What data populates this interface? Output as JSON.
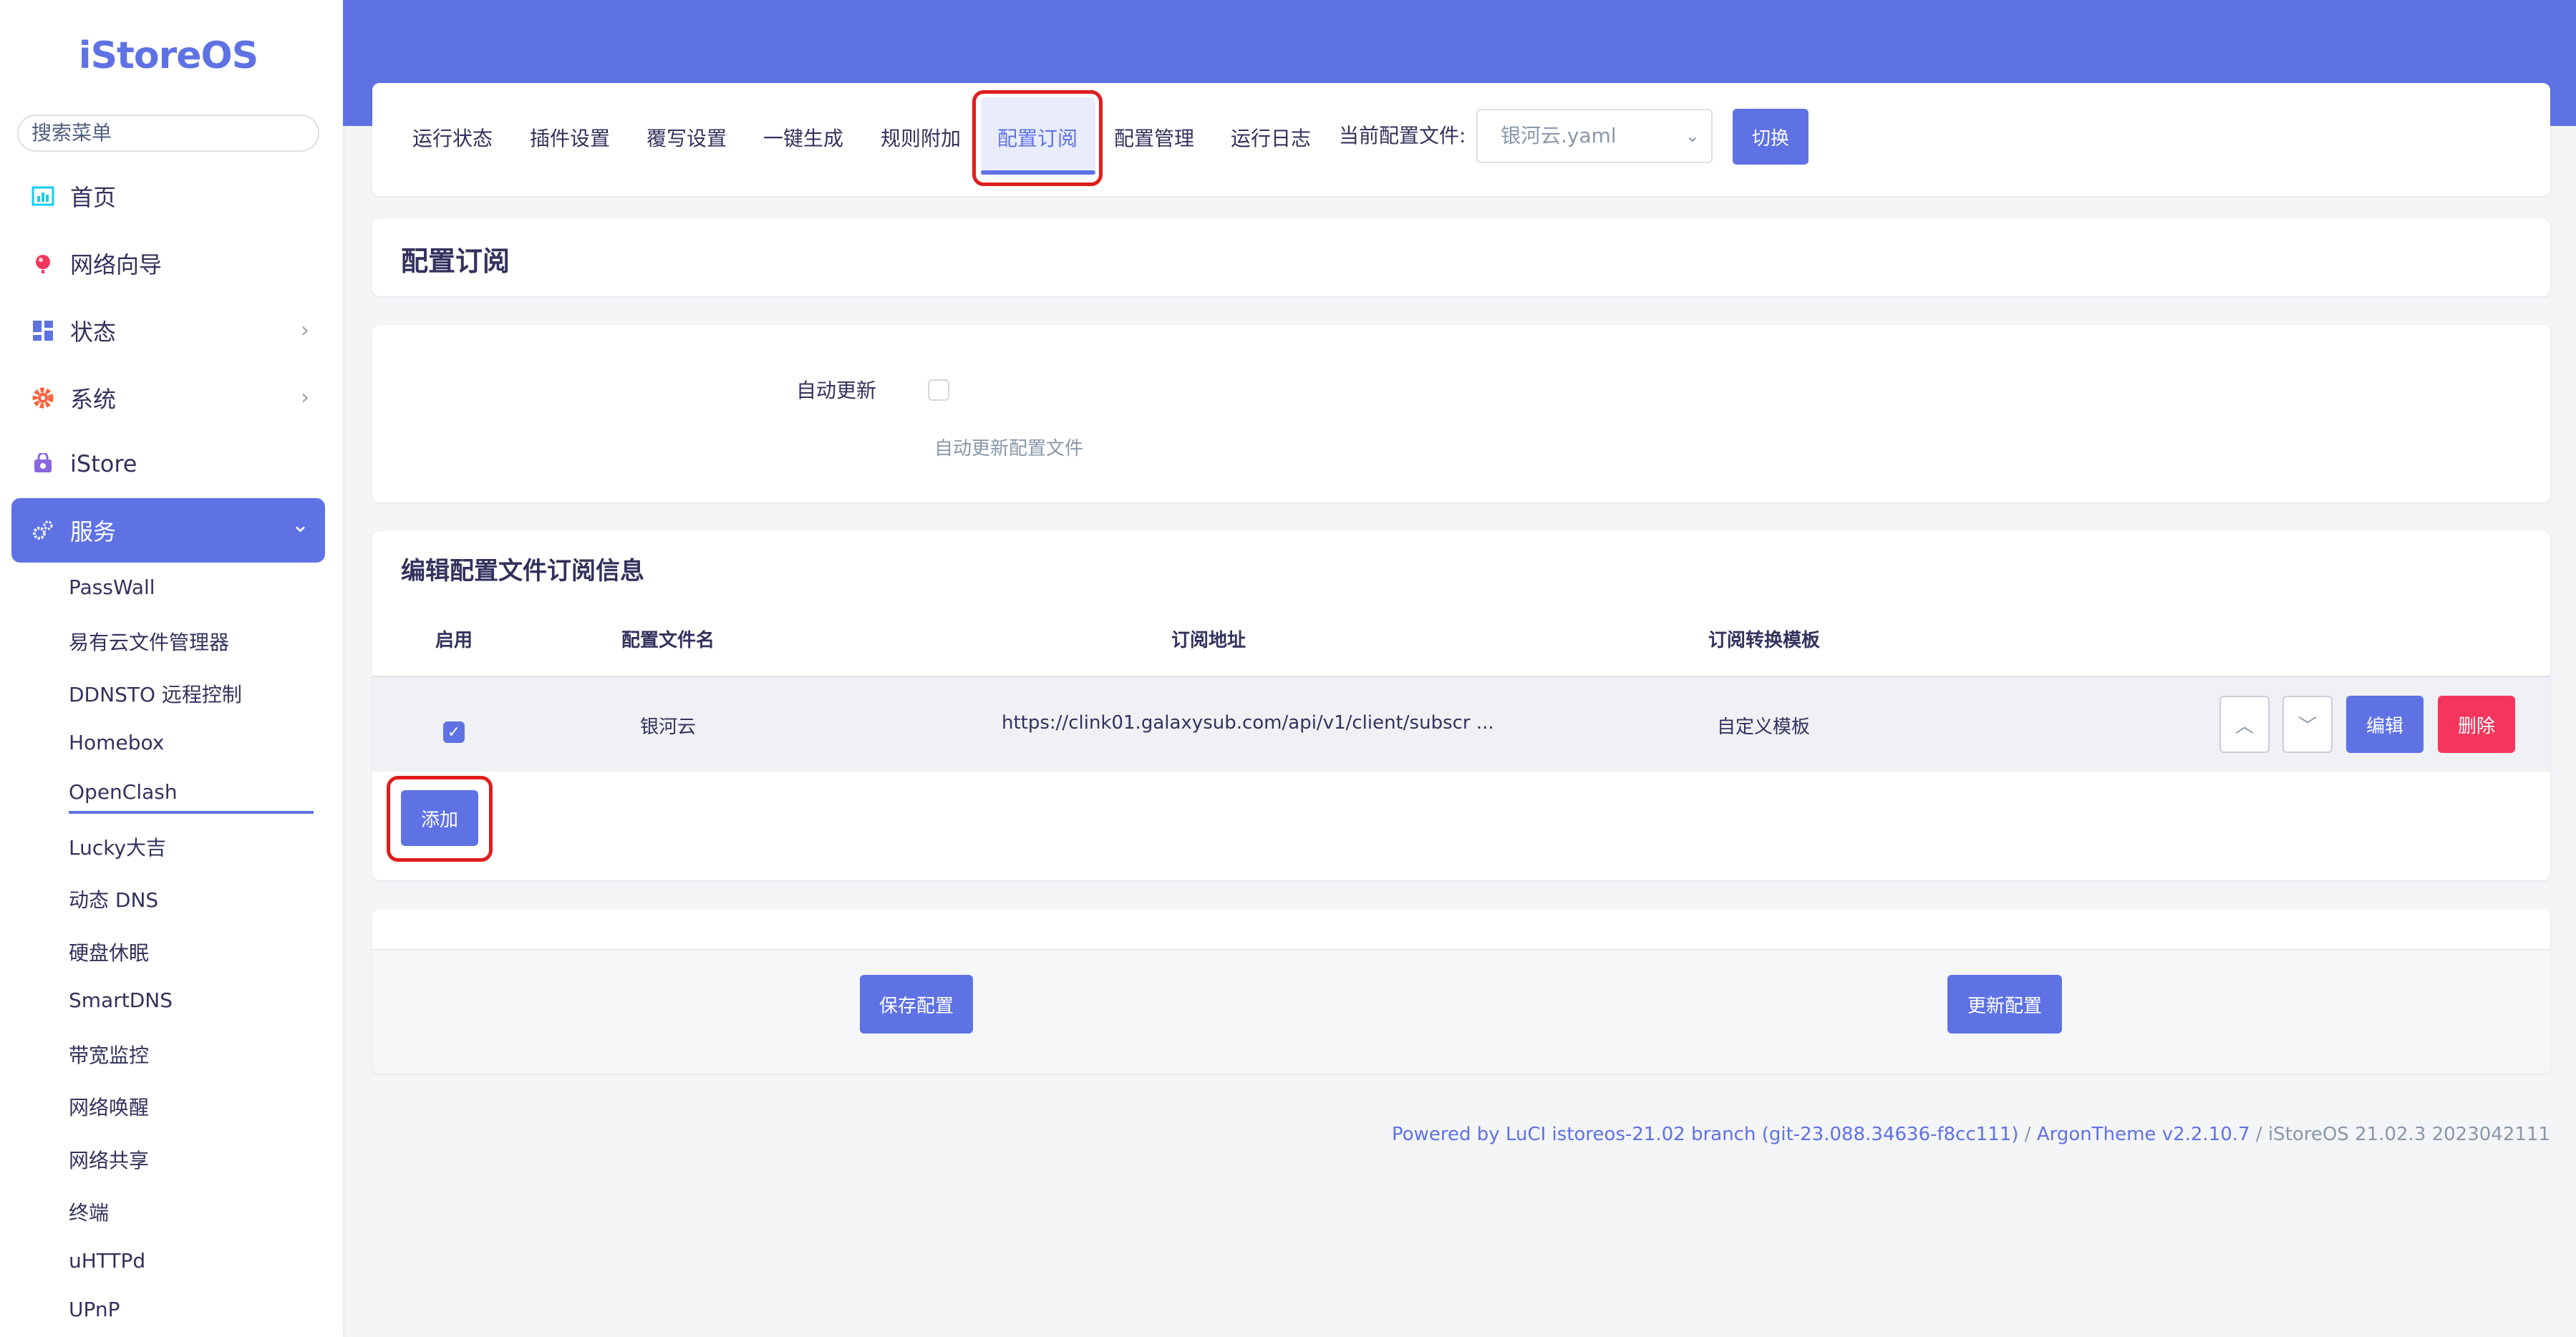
{
  "sidebar": {
    "logo": "iStoreOS",
    "search_placeholder": "搜索菜单",
    "nav": [
      {
        "label": "首页",
        "icon": "dashboard-icon"
      },
      {
        "label": "网络向导",
        "icon": "globe-icon"
      },
      {
        "label": "状态",
        "icon": "grid-icon"
      },
      {
        "label": "系统",
        "icon": "gear-icon"
      },
      {
        "label": "iStore",
        "icon": "store-icon"
      },
      {
        "label": "服务",
        "icon": "services-icon"
      }
    ],
    "services": [
      "PassWall",
      "易有云文件管理器",
      "DDNSTO 远程控制",
      "Homebox",
      "OpenClash",
      "Lucky大吉",
      "动态 DNS",
      "硬盘休眠",
      "SmartDNS",
      "带宽监控",
      "网络唤醒",
      "网络共享",
      "终端",
      "uHTTPd",
      "UPnP"
    ]
  },
  "tabs": [
    "运行状态",
    "插件设置",
    "覆写设置",
    "一键生成",
    "规则附加",
    "配置订阅",
    "配置管理",
    "运行日志"
  ],
  "config_file": {
    "label": "当前配置文件:",
    "selected": "银河云.yaml",
    "switch_label": "切换"
  },
  "page_title": "配置订阅",
  "auto_update": {
    "label": "自动更新",
    "checked": false,
    "hint": "自动更新配置文件"
  },
  "subscription": {
    "title": "编辑配置文件订阅信息",
    "headers": [
      "启用",
      "配置文件名",
      "订阅地址",
      "订阅转换模板"
    ],
    "rows": [
      {
        "enabled": true,
        "name": "银河云",
        "url": "https://clink01.galaxysub.com/api/v1/client/subscr ...",
        "template": "自定义模板"
      }
    ],
    "edit_label": "编辑",
    "delete_label": "删除",
    "add_label": "添加"
  },
  "actions": {
    "save_label": "保存配置",
    "update_label": "更新配置"
  },
  "footer": {
    "powered": "Powered by LuCI istoreos-21.02 branch (git-23.088.34636-f8cc111)",
    "sep1": " / ",
    "theme": "ArgonTheme v2.2.10.7",
    "sep2": " / ",
    "version": "iStoreOS 21.02.3 2023042111"
  },
  "colors": {
    "accent": "#5e72e4",
    "danger": "#f5365c",
    "highlight": "#e01d1d"
  }
}
